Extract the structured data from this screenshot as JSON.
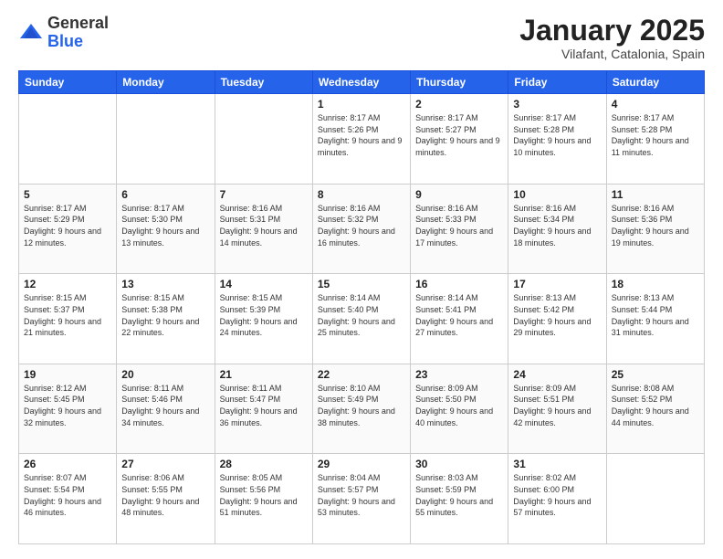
{
  "logo": {
    "general": "General",
    "blue": "Blue"
  },
  "header": {
    "month": "January 2025",
    "location": "Vilafant, Catalonia, Spain"
  },
  "weekdays": [
    "Sunday",
    "Monday",
    "Tuesday",
    "Wednesday",
    "Thursday",
    "Friday",
    "Saturday"
  ],
  "weeks": [
    [
      {
        "day": "",
        "info": ""
      },
      {
        "day": "",
        "info": ""
      },
      {
        "day": "",
        "info": ""
      },
      {
        "day": "1",
        "info": "Sunrise: 8:17 AM\nSunset: 5:26 PM\nDaylight: 9 hours and 9 minutes."
      },
      {
        "day": "2",
        "info": "Sunrise: 8:17 AM\nSunset: 5:27 PM\nDaylight: 9 hours and 9 minutes."
      },
      {
        "day": "3",
        "info": "Sunrise: 8:17 AM\nSunset: 5:28 PM\nDaylight: 9 hours and 10 minutes."
      },
      {
        "day": "4",
        "info": "Sunrise: 8:17 AM\nSunset: 5:28 PM\nDaylight: 9 hours and 11 minutes."
      }
    ],
    [
      {
        "day": "5",
        "info": "Sunrise: 8:17 AM\nSunset: 5:29 PM\nDaylight: 9 hours and 12 minutes."
      },
      {
        "day": "6",
        "info": "Sunrise: 8:17 AM\nSunset: 5:30 PM\nDaylight: 9 hours and 13 minutes."
      },
      {
        "day": "7",
        "info": "Sunrise: 8:16 AM\nSunset: 5:31 PM\nDaylight: 9 hours and 14 minutes."
      },
      {
        "day": "8",
        "info": "Sunrise: 8:16 AM\nSunset: 5:32 PM\nDaylight: 9 hours and 16 minutes."
      },
      {
        "day": "9",
        "info": "Sunrise: 8:16 AM\nSunset: 5:33 PM\nDaylight: 9 hours and 17 minutes."
      },
      {
        "day": "10",
        "info": "Sunrise: 8:16 AM\nSunset: 5:34 PM\nDaylight: 9 hours and 18 minutes."
      },
      {
        "day": "11",
        "info": "Sunrise: 8:16 AM\nSunset: 5:36 PM\nDaylight: 9 hours and 19 minutes."
      }
    ],
    [
      {
        "day": "12",
        "info": "Sunrise: 8:15 AM\nSunset: 5:37 PM\nDaylight: 9 hours and 21 minutes."
      },
      {
        "day": "13",
        "info": "Sunrise: 8:15 AM\nSunset: 5:38 PM\nDaylight: 9 hours and 22 minutes."
      },
      {
        "day": "14",
        "info": "Sunrise: 8:15 AM\nSunset: 5:39 PM\nDaylight: 9 hours and 24 minutes."
      },
      {
        "day": "15",
        "info": "Sunrise: 8:14 AM\nSunset: 5:40 PM\nDaylight: 9 hours and 25 minutes."
      },
      {
        "day": "16",
        "info": "Sunrise: 8:14 AM\nSunset: 5:41 PM\nDaylight: 9 hours and 27 minutes."
      },
      {
        "day": "17",
        "info": "Sunrise: 8:13 AM\nSunset: 5:42 PM\nDaylight: 9 hours and 29 minutes."
      },
      {
        "day": "18",
        "info": "Sunrise: 8:13 AM\nSunset: 5:44 PM\nDaylight: 9 hours and 31 minutes."
      }
    ],
    [
      {
        "day": "19",
        "info": "Sunrise: 8:12 AM\nSunset: 5:45 PM\nDaylight: 9 hours and 32 minutes."
      },
      {
        "day": "20",
        "info": "Sunrise: 8:11 AM\nSunset: 5:46 PM\nDaylight: 9 hours and 34 minutes."
      },
      {
        "day": "21",
        "info": "Sunrise: 8:11 AM\nSunset: 5:47 PM\nDaylight: 9 hours and 36 minutes."
      },
      {
        "day": "22",
        "info": "Sunrise: 8:10 AM\nSunset: 5:49 PM\nDaylight: 9 hours and 38 minutes."
      },
      {
        "day": "23",
        "info": "Sunrise: 8:09 AM\nSunset: 5:50 PM\nDaylight: 9 hours and 40 minutes."
      },
      {
        "day": "24",
        "info": "Sunrise: 8:09 AM\nSunset: 5:51 PM\nDaylight: 9 hours and 42 minutes."
      },
      {
        "day": "25",
        "info": "Sunrise: 8:08 AM\nSunset: 5:52 PM\nDaylight: 9 hours and 44 minutes."
      }
    ],
    [
      {
        "day": "26",
        "info": "Sunrise: 8:07 AM\nSunset: 5:54 PM\nDaylight: 9 hours and 46 minutes."
      },
      {
        "day": "27",
        "info": "Sunrise: 8:06 AM\nSunset: 5:55 PM\nDaylight: 9 hours and 48 minutes."
      },
      {
        "day": "28",
        "info": "Sunrise: 8:05 AM\nSunset: 5:56 PM\nDaylight: 9 hours and 51 minutes."
      },
      {
        "day": "29",
        "info": "Sunrise: 8:04 AM\nSunset: 5:57 PM\nDaylight: 9 hours and 53 minutes."
      },
      {
        "day": "30",
        "info": "Sunrise: 8:03 AM\nSunset: 5:59 PM\nDaylight: 9 hours and 55 minutes."
      },
      {
        "day": "31",
        "info": "Sunrise: 8:02 AM\nSunset: 6:00 PM\nDaylight: 9 hours and 57 minutes."
      },
      {
        "day": "",
        "info": ""
      }
    ]
  ]
}
